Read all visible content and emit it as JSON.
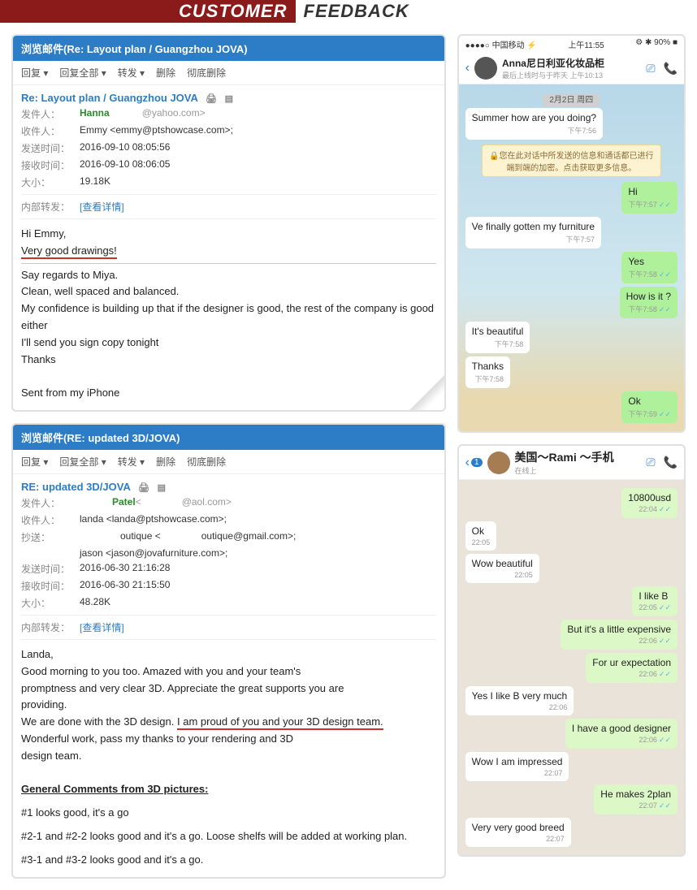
{
  "banner": {
    "left": "CUSTOMER",
    "right": "FEEDBACK"
  },
  "email1": {
    "titlebar": "浏览邮件(Re: Layout plan / Guangzhou JOVA)",
    "toolbar": [
      "回复 ▾",
      "回复全部 ▾",
      "转发 ▾",
      "删除",
      "彻底删除"
    ],
    "subject": "Re: Layout plan / Guangzhou JOVA",
    "meta": {
      "from_label": "发件人：",
      "from_name": "Hanna",
      "from_addr": "@yahoo.com>",
      "to_label": "收件人：",
      "to": "Emmy <emmy@ptshowcase.com>;",
      "sent_label": "发送时间：",
      "sent": "2016-09-10 08:05:56",
      "recv_label": "接收时间：",
      "recv": "2016-09-10 08:06:05",
      "size_label": "大小：",
      "size": "19.18K",
      "fwd_label": "内部转发：",
      "fwd_link": "[查看详情]"
    },
    "body": {
      "l1": "Hi Emmy,",
      "l2": "Very good drawings!",
      "l3": "Say regards to Miya.",
      "l4": "Clean, well spaced and balanced.",
      "l5": "My confidence is building up that if the designer is good, the rest of the company is good either",
      "l6": "I'll send you sign copy tonight",
      "l7": "Thanks",
      "l8": "Sent from my iPhone"
    }
  },
  "email2": {
    "titlebar": "浏览邮件(RE: updated 3D/JOVA)",
    "toolbar": [
      "回复 ▾",
      "回复全部 ▾",
      "转发 ▾",
      "删除",
      "彻底删除"
    ],
    "subject": "RE: updated 3D/JOVA",
    "meta": {
      "from_label": "发件人：",
      "from_name": "Patel",
      "from_addr": "@aol.com>",
      "to_label": "收件人：",
      "to": "landa <landa@ptshowcase.com>;",
      "cc_label": "抄送：",
      "cc1": "outique <",
      "cc2": "outique@gmail.com>;",
      "cc3": "jason <jason@jovafurniture.com>;",
      "sent_label": "发送时间：",
      "sent": "2016-06-30 21:16:28",
      "recv_label": "接收时间：",
      "recv": "2016-06-30 21:15:50",
      "size_label": "大小：",
      "size": "48.28K",
      "fwd_label": "内部转发：",
      "fwd_link": "[查看详情]"
    },
    "body": {
      "l1": "Landa,",
      "l2": "Good morning to you too.  Amazed with you and your team's",
      "l3": "promptness and very clear 3D.  Appreciate the great supports you are",
      "l4": "providing.",
      "l5a": "We are done with the 3D design.  ",
      "l5b": "I am proud of you and your 3D design team.",
      "l6": "Wonderful work, pass my thanks to your rendering and 3D",
      "l7": "design team.",
      "h1": "General Comments from 3D pictures:",
      "c1": "#1 looks good, it's a go",
      "c2": "#2-1 and #2-2 looks good and it's a go.  Loose shelfs will be added at working plan.",
      "c3": "#3-1 and #3-2 looks good and it's a go."
    }
  },
  "chat1": {
    "status": {
      "carrier": "●●●●○ 中国移动 ⚡",
      "time": "上午11:55",
      "batt": "⚙ ✱ 90% ■"
    },
    "name": "Anna尼日利亚化妆品柜",
    "sub": "最后上线时与于昨天 上午10:13",
    "date": "2月2日 周四",
    "notice": "🔒您在此对话中所发送的信息和通话都已进行端到端的加密。点击获取更多信息。",
    "msgs": [
      {
        "side": "left",
        "style": "white",
        "text": "Summer how are you doing?",
        "time": "下午7:56"
      },
      {
        "side": "right",
        "style": "green",
        "text": "Hi",
        "time": "下午7:57 ✓✓"
      },
      {
        "side": "left",
        "style": "white",
        "text": "Ve finally gotten my furniture",
        "time": "下午7:57"
      },
      {
        "side": "right",
        "style": "green",
        "text": "Yes",
        "time": "下午7:58 ✓✓"
      },
      {
        "side": "right",
        "style": "green",
        "text": "How is it ?",
        "time": "下午7:58 ✓✓"
      },
      {
        "side": "left",
        "style": "white",
        "text": "It's beautiful",
        "time": "下午7:58"
      },
      {
        "side": "left",
        "style": "white",
        "text": "Thanks",
        "time": "下午7:58"
      },
      {
        "side": "right",
        "style": "green",
        "text": "Ok",
        "time": "下午7:59 ✓✓"
      }
    ]
  },
  "chat2": {
    "badge": "1",
    "name": "美国～Rami ～手机",
    "sub": "在线上",
    "msgs": [
      {
        "side": "right",
        "style": "wa-green",
        "text": "10800usd",
        "time": "22:04 ✓✓"
      },
      {
        "side": "left",
        "style": "white",
        "text": "Ok",
        "time": "22:05"
      },
      {
        "side": "left",
        "style": "white",
        "text": "Wow beautiful",
        "time": "22:05"
      },
      {
        "side": "right",
        "style": "wa-green",
        "text": "I like B",
        "time": "22:05 ✓✓"
      },
      {
        "side": "right",
        "style": "wa-green",
        "text": "But it's a little expensive",
        "time": "22:06 ✓✓"
      },
      {
        "side": "right",
        "style": "wa-green",
        "text": "For ur expectation",
        "time": "22:06 ✓✓"
      },
      {
        "side": "left",
        "style": "white",
        "text": "Yes I like B very much",
        "time": "22:06"
      },
      {
        "side": "right",
        "style": "wa-green",
        "text": "I have a good designer",
        "time": "22:06 ✓✓"
      },
      {
        "side": "left",
        "style": "white",
        "text": "Wow I am impressed",
        "time": "22:07"
      },
      {
        "side": "right",
        "style": "wa-green",
        "text": "He makes 2plan",
        "time": "22:07 ✓✓"
      },
      {
        "side": "left",
        "style": "white",
        "text": "Very very good breed",
        "time": "22:07"
      }
    ]
  }
}
